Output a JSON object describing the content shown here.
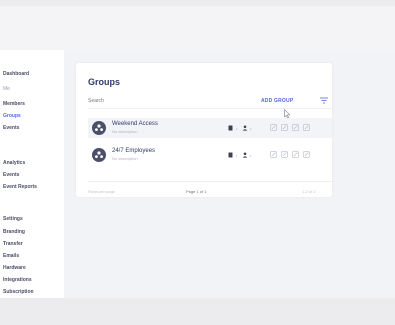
{
  "sidebar": {
    "items": [
      {
        "label": "Dashboard",
        "active": false,
        "dim": false
      },
      {
        "label": "Me",
        "active": false,
        "dim": true
      },
      {
        "label": "Members",
        "active": false,
        "dim": false
      },
      {
        "label": "Groups",
        "active": true,
        "dim": false
      },
      {
        "label": "Events",
        "active": false,
        "dim": false
      },
      {
        "label": "Analytics",
        "active": false,
        "dim": false
      },
      {
        "label": "Events",
        "active": false,
        "dim": false
      },
      {
        "label": "Event Reports",
        "active": false,
        "dim": false
      },
      {
        "label": "Settings",
        "active": false,
        "dim": false
      },
      {
        "label": "Branding",
        "active": false,
        "dim": false
      },
      {
        "label": "Transfer",
        "active": false,
        "dim": false
      },
      {
        "label": "Emails",
        "active": false,
        "dim": false
      },
      {
        "label": "Hardware",
        "active": false,
        "dim": false
      },
      {
        "label": "Integrations",
        "active": false,
        "dim": false
      },
      {
        "label": "Subscription",
        "active": false,
        "dim": false
      }
    ]
  },
  "groups": {
    "title": "Groups",
    "search_placeholder": "Search",
    "add_label": "ADD GROUP",
    "rows": [
      {
        "name": "Weekend Access",
        "description": "No description"
      },
      {
        "name": "24/7 Employees",
        "description": "No description"
      }
    ],
    "footer": {
      "left": "Rows per page",
      "page": "Page 1 of 1",
      "right": "1-2 of 2"
    }
  },
  "colors": {
    "accent": "#4f6ad8",
    "title": "#2f3a6b",
    "avatar": "#4a4f6a"
  }
}
